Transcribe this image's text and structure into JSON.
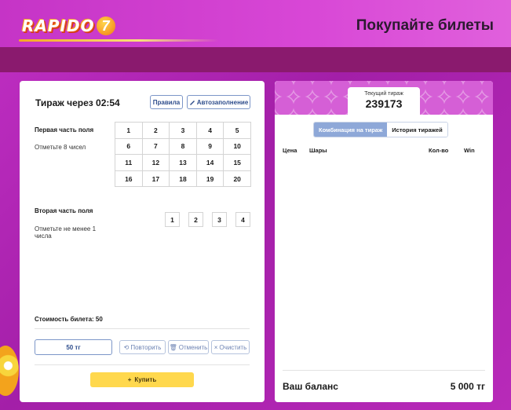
{
  "header": {
    "logo_text": "RAPIDO",
    "logo_number": "7",
    "title": "Покупайте билеты"
  },
  "ticket": {
    "timer": "Тираж через 02:54",
    "rules_label": "Правила",
    "auto_label": "Автозаполнение",
    "first_part_title": "Первая часть поля",
    "first_part_hint": "Отметьте 8 чисел",
    "first_grid": [
      "1",
      "2",
      "3",
      "4",
      "5",
      "6",
      "7",
      "8",
      "9",
      "10",
      "11",
      "12",
      "13",
      "14",
      "15",
      "16",
      "17",
      "18",
      "19",
      "20"
    ],
    "second_part_title": "Вторая часть поля",
    "second_part_hint_line1": "Отметьте не менее 1",
    "second_part_hint_line2": "числа",
    "second_grid": [
      "1",
      "2",
      "3",
      "4"
    ],
    "cost": "Стоимость билета: 50",
    "amount": "50 тг",
    "repeat_label": "Повторить",
    "cancel_label": "Отменить",
    "clear_label": "Очистить",
    "buy_label": "Купить"
  },
  "draw": {
    "current_label": "Текущий тираж",
    "current_number": "239173",
    "tab_combinations": "Комбинация на тираж",
    "tab_history": "История тиражей",
    "columns": [
      "Цена",
      "Шары",
      "Кол-во",
      "Win"
    ],
    "balance_label": "Ваш баланс",
    "balance_value": "5 000 тг"
  },
  "colors": {
    "background": "#b12ab6",
    "accent_blue": "#2e4d8c",
    "buy_yellow": "#ffd84d",
    "dark_band": "#8a1a6e"
  }
}
